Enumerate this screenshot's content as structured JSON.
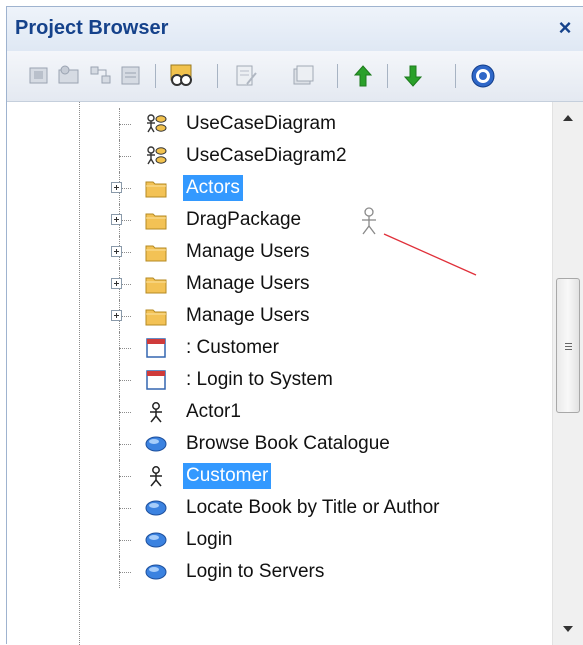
{
  "panel": {
    "title": "Project Browser",
    "close_label": "×"
  },
  "toolbar": {
    "buttons": [
      "new-package-icon",
      "new-view-icon",
      "new-diagram-icon",
      "new-element-icon",
      "find-in-tree-icon",
      "properties-icon",
      "add-element-icon",
      "move-up-icon",
      "move-down-icon",
      "help-icon"
    ]
  },
  "tree": {
    "items": [
      {
        "label": "UseCaseDiagram",
        "icon": "use-case-diagram-icon",
        "expandable": false,
        "selected": false
      },
      {
        "label": "UseCaseDiagram2",
        "icon": "use-case-diagram-icon",
        "expandable": false,
        "selected": false
      },
      {
        "label": "Actors",
        "icon": "folder-icon",
        "expandable": true,
        "selected": true
      },
      {
        "label": "DragPackage",
        "icon": "folder-icon",
        "expandable": true,
        "selected": false
      },
      {
        "label": "Manage Users",
        "icon": "folder-icon",
        "expandable": true,
        "selected": false
      },
      {
        "label": "Manage Users",
        "icon": "folder-icon",
        "expandable": true,
        "selected": false
      },
      {
        "label": "Manage Users",
        "icon": "folder-icon",
        "expandable": true,
        "selected": false
      },
      {
        "label": ": Customer",
        "icon": "instance-icon",
        "expandable": false,
        "selected": false
      },
      {
        "label": ": Login to System",
        "icon": "instance-icon",
        "expandable": false,
        "selected": false
      },
      {
        "label": "Actor1",
        "icon": "actor-icon",
        "expandable": false,
        "selected": false
      },
      {
        "label": "Browse Book Catalogue",
        "icon": "use-case-icon",
        "expandable": false,
        "selected": false
      },
      {
        "label": "Customer",
        "icon": "actor-icon",
        "expandable": false,
        "selected": true
      },
      {
        "label": "Locate Book by Title or Author",
        "icon": "use-case-icon",
        "expandable": false,
        "selected": false
      },
      {
        "label": "Login",
        "icon": "use-case-icon",
        "expandable": false,
        "selected": false
      },
      {
        "label": "Login to Servers",
        "icon": "use-case-icon",
        "expandable": false,
        "selected": false
      }
    ]
  },
  "scroll": {
    "position_fraction": 0.42,
    "visible_fraction": 0.28
  },
  "colors": {
    "title_text": "#15428b",
    "selection": "#3399ff",
    "folder": "#f3c255",
    "use_case": "#3b82e0",
    "move_up_arrow": "#2aa02a",
    "move_down_arrow": "#2aa02a",
    "drag_line": "#e0303a"
  }
}
